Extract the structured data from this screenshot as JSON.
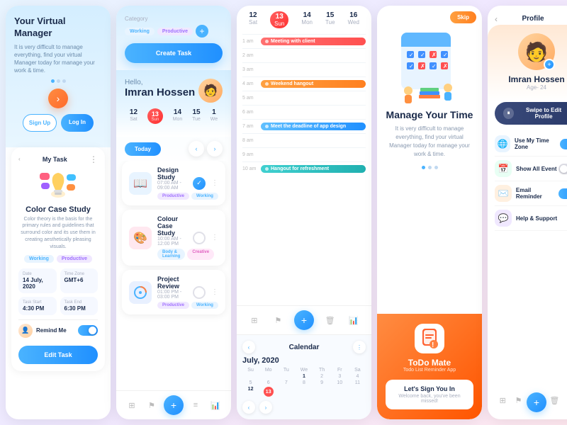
{
  "panel1": {
    "title": "Your Virtual Manager",
    "desc": "It is very difficult to manage everything, find your virtual Manager today for manage your work & time.",
    "signup_label": "Sign Up",
    "login_label": "Log In",
    "task_title": "My Task",
    "color_case_title": "Color Case Study",
    "color_case_desc": "Color theory is the basis for the primary rules and guidelines that surround color and its use them in creating aesthetically pleasing visuals.",
    "tags": [
      "Working",
      "Productive"
    ],
    "date_label": "Date",
    "date_value": "14 July, 2020",
    "timezone_label": "Time Zone",
    "timezone_value": "GMT+6",
    "task_start_label": "Task Start",
    "task_start_value": "4:30 PM",
    "task_end_label": "Task End",
    "task_end_value": "6:30 PM",
    "remind_label": "Remind Me",
    "edit_label": "Edit Task"
  },
  "panel2": {
    "category_label": "Category",
    "cat_tags": [
      "Working",
      "Productive"
    ],
    "create_task_label": "Create Task",
    "hello": "Hello,",
    "name": "Imran Hossen",
    "today_label": "Today",
    "days": [
      {
        "num": "12",
        "name": "Sat"
      },
      {
        "num": "13",
        "name": "Sun",
        "active": true
      },
      {
        "num": "14",
        "name": "Mon"
      },
      {
        "num": "15",
        "name": "Tue"
      },
      {
        "num": "1",
        "name": "We"
      }
    ],
    "tasks": [
      {
        "name": "Design Study",
        "time": "07:00 AM - 09:00 AM",
        "tags": [
          "Productive",
          "Working"
        ],
        "icon": "📖",
        "icon_bg": "#e8f4ff",
        "done": true
      },
      {
        "name": "Colour Case Study",
        "time": "10:00 AM - 12:00 PM",
        "tags": [
          "Body & Learning",
          "Creative"
        ],
        "icon": "🎨",
        "icon_bg": "#ffe8e8",
        "done": false
      },
      {
        "name": "Project Review",
        "time": "01:00 PM - 03:00 PM",
        "tags": [
          "Productive",
          "Working"
        ],
        "icon": "🔄",
        "icon_bg": "#e8f0ff",
        "done": false
      }
    ]
  },
  "panel3": {
    "schedule_days": [
      {
        "num": "12",
        "name": "Sat"
      },
      {
        "num": "13",
        "name": "Sun",
        "active": true
      },
      {
        "num": "14",
        "name": "Mon"
      },
      {
        "num": "15",
        "name": "Tue"
      },
      {
        "num": "16",
        "name": "Wed"
      }
    ],
    "times": [
      "1 am",
      "2 am",
      "3 am",
      "4 am",
      "5 am",
      "6 am",
      "7 am",
      "8 am",
      "9 am",
      "10 am"
    ],
    "events": [
      {
        "time_idx": 0,
        "label": "Meeting with client",
        "type": "red"
      },
      {
        "time_idx": 3,
        "label": "Weekend hangout",
        "type": "orange"
      },
      {
        "time_idx": 6,
        "label": "Meet the deadline of app design",
        "type": "blue"
      },
      {
        "time_idx": 9,
        "label": "Hangout for refreshment",
        "type": "cyan"
      }
    ],
    "calendar_label": "Calendar",
    "month": "July, 2020"
  },
  "panel4": {
    "skip_label": "Skip",
    "title": "Manage Your Time",
    "desc": "It is very difficult to manage everything, find your virtual Manager today for manage your work & time.",
    "todo_title": "ToDo Mate",
    "todo_subtitle": "Todo List Reminder App",
    "sign_in_title": "Let's Sign You In",
    "sign_in_desc": "Welcome back, you've been missed!"
  },
  "panel5": {
    "back": "‹",
    "title": "Profile",
    "dots": "⋮",
    "avatar_emoji": "🧑",
    "name": "Imran Hossen",
    "age": "Age- 24",
    "swipe_label": "Swipe to Edit Profile",
    "settings": [
      {
        "label": "Use My Time Zone",
        "icon": "🌐",
        "bg": "#e8f4ff",
        "toggle": true
      },
      {
        "label": "Show All Event",
        "icon": "📅",
        "bg": "#e8fff4",
        "toggle": false
      },
      {
        "label": "Email Reminder",
        "icon": "✉️",
        "bg": "#fff0e0",
        "toggle": true
      },
      {
        "label": "Help & Support",
        "icon": "💬",
        "bg": "#f0e8ff",
        "toggle": null
      }
    ]
  },
  "colors": {
    "accent_blue": "#4ab3ff",
    "accent_orange": "#ff8c42",
    "accent_red": "#ff5050",
    "text_dark": "#1a2a4a",
    "text_muted": "#aab0c0"
  }
}
